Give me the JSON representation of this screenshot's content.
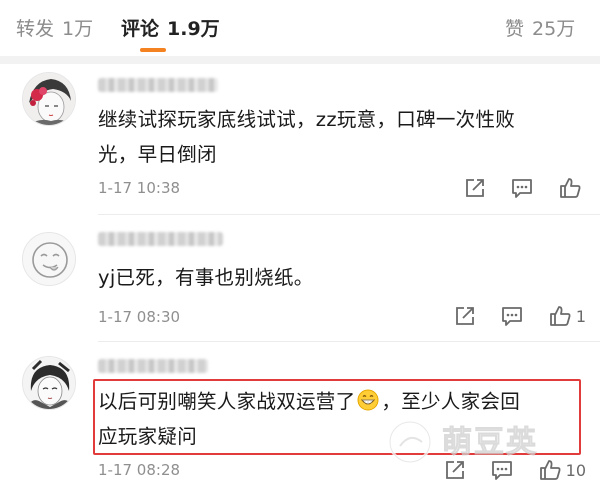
{
  "tabs": [
    {
      "label": "转发",
      "count": "1万",
      "active": false
    },
    {
      "label": "评论",
      "count": "1.9万",
      "active": true
    },
    {
      "label": "赞",
      "count": "25万",
      "active": false
    }
  ],
  "colors": {
    "accent": "#f58220",
    "highlight": "#e23b3b"
  },
  "comments": [
    {
      "avatar_icon": "anime-girl-red-avatar",
      "text_lines": [
        "继续试探玩家底线试试，zz玩意，口碑一次性败",
        "光，早日倒闭"
      ],
      "time": "1-17 10:38",
      "likes": ""
    },
    {
      "avatar_icon": "tongue-out-face-avatar",
      "text_lines": [
        "yj已死，有事也别烧纸。"
      ],
      "time": "1-17 08:30",
      "likes": "1"
    },
    {
      "avatar_icon": "anime-girl-sketch-avatar",
      "text_lines_a": [
        "以后可别嘲笑人家战双运营了",
        "，至少人家会回"
      ],
      "text_line_b": "应玩家疑问",
      "time": "1-17 08:28",
      "likes": "10",
      "highlighted": true
    }
  ],
  "watermark_text": "萌豆英"
}
